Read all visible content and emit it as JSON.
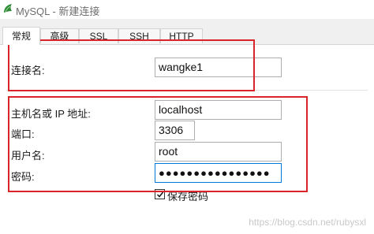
{
  "window": {
    "title": "MySQL - 新建连接",
    "icon": "mysql-dolphin-icon",
    "accent_color": "#0078d7"
  },
  "tabs": [
    {
      "label": "常规",
      "active": true
    },
    {
      "label": "高级",
      "active": false
    },
    {
      "label": "SSL",
      "active": false
    },
    {
      "label": "SSH",
      "active": false
    },
    {
      "label": "HTTP",
      "active": false
    }
  ],
  "form": {
    "connection_name": {
      "label": "连接名:",
      "value": "wangke1"
    },
    "host": {
      "label": "主机名或 IP 地址:",
      "value": "localhost"
    },
    "port": {
      "label": "端口:",
      "value": "3306"
    },
    "username": {
      "label": "用户名:",
      "value": "root"
    },
    "password": {
      "label": "密码:",
      "value": "●●●●●●●●●●●●●●●●"
    },
    "save_password": {
      "label": "保存密码",
      "checked": true
    }
  },
  "annotation_color": "#d9242c",
  "watermark": "https://blog.csdn.net/rubysxl"
}
